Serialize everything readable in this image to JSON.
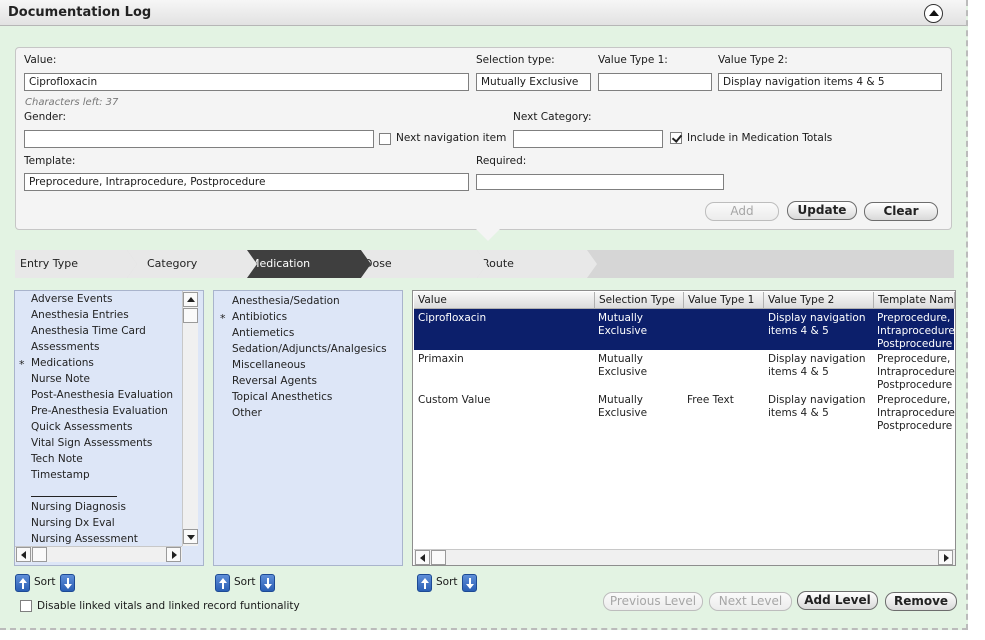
{
  "window": {
    "title": "Documentation Log"
  },
  "form": {
    "value_label": "Value:",
    "value": "Ciprofloxacin",
    "chars_left": "Characters left: 37",
    "selection_type_label": "Selection type:",
    "selection_type": "Mutually Exclusive",
    "value_type1_label": "Value Type 1:",
    "value_type1": "",
    "value_type2_label": "Value Type 2:",
    "value_type2": "Display navigation items 4 & 5",
    "gender_label": "Gender:",
    "gender": "",
    "next_nav_label": "Next navigation item",
    "next_nav_checked": false,
    "next_category_label": "Next Category:",
    "next_category": "",
    "include_med_label": "Include in Medication Totals",
    "include_med_checked": true,
    "template_label": "Template:",
    "template": "Preprocedure, Intraprocedure, Postprocedure",
    "required_label": "Required:",
    "required": "",
    "add_label": "Add",
    "update_label": "Update",
    "clear_label": "Clear"
  },
  "breadcrumbs": [
    {
      "label": "Entry Type",
      "active": false
    },
    {
      "label": "Category",
      "active": false
    },
    {
      "label": "Medication",
      "active": true
    },
    {
      "label": "Dose",
      "active": false
    },
    {
      "label": "Route",
      "active": false
    }
  ],
  "entry_types": [
    {
      "label": "Adverse Events",
      "marked": false
    },
    {
      "label": "Anesthesia Entries",
      "marked": false
    },
    {
      "label": "Anesthesia Time Card",
      "marked": false
    },
    {
      "label": "Assessments",
      "marked": false
    },
    {
      "label": "Medications",
      "marked": true
    },
    {
      "label": "Nurse Note",
      "marked": false
    },
    {
      "label": "Post-Anesthesia Evaluation",
      "marked": false
    },
    {
      "label": "Pre-Anesthesia Evaluation",
      "marked": false
    },
    {
      "label": "Quick Assessments",
      "marked": false
    },
    {
      "label": "Vital Sign Assessments",
      "marked": false
    },
    {
      "label": "Tech Note",
      "marked": false
    },
    {
      "label": "Timestamp",
      "marked": false
    },
    {
      "label": "Nursing Diagnosis",
      "marked": false
    },
    {
      "label": "Nursing Dx Eval",
      "marked": false
    },
    {
      "label": "Nursing Assessment",
      "marked": false
    }
  ],
  "categories": [
    {
      "label": "Anesthesia/Sedation",
      "marked": false
    },
    {
      "label": "Antibiotics",
      "marked": true
    },
    {
      "label": "Antiemetics",
      "marked": false
    },
    {
      "label": "Sedation/Adjuncts/Analgesics",
      "marked": false
    },
    {
      "label": "Miscellaneous",
      "marked": false
    },
    {
      "label": "Reversal Agents",
      "marked": false
    },
    {
      "label": "Topical Anesthetics",
      "marked": false
    },
    {
      "label": "Other",
      "marked": false
    }
  ],
  "star": "*",
  "table": {
    "columns": [
      "Value",
      "Selection Type",
      "Value Type 1",
      "Value Type 2",
      "Template Name"
    ],
    "rows": [
      {
        "selected": true,
        "cells": [
          "Ciprofloxacin",
          "Mutually\nExclusive",
          "",
          "Display navigation\nitems 4 & 5",
          "Preprocedure,\nIntraprocedure,\nPostprocedure"
        ]
      },
      {
        "selected": false,
        "cells": [
          "Primaxin",
          "Mutually\nExclusive",
          "",
          "Display navigation\nitems 4 & 5",
          "Preprocedure,\nIntraprocedure,\nPostprocedure"
        ]
      },
      {
        "selected": false,
        "cells": [
          "Custom Value",
          "Mutually\nExclusive",
          "Free Text",
          "Display navigation\nitems 4 & 5",
          "Preprocedure,\nIntraprocedure,\nPostprocedure"
        ]
      }
    ]
  },
  "sort_label": "Sort",
  "footer": {
    "disable_linked_label": "Disable linked vitals and linked record funtionality",
    "disable_linked_checked": false,
    "previous_level_label": "Previous Level",
    "next_level_label": "Next Level",
    "add_level_label": "Add Level",
    "remove_label": "Remove"
  },
  "colors": {
    "background": "#e3f3e3",
    "list_background": "#dde6f7",
    "selected_row": "#0c1f6b",
    "active_crumb": "#3f3f3f"
  }
}
